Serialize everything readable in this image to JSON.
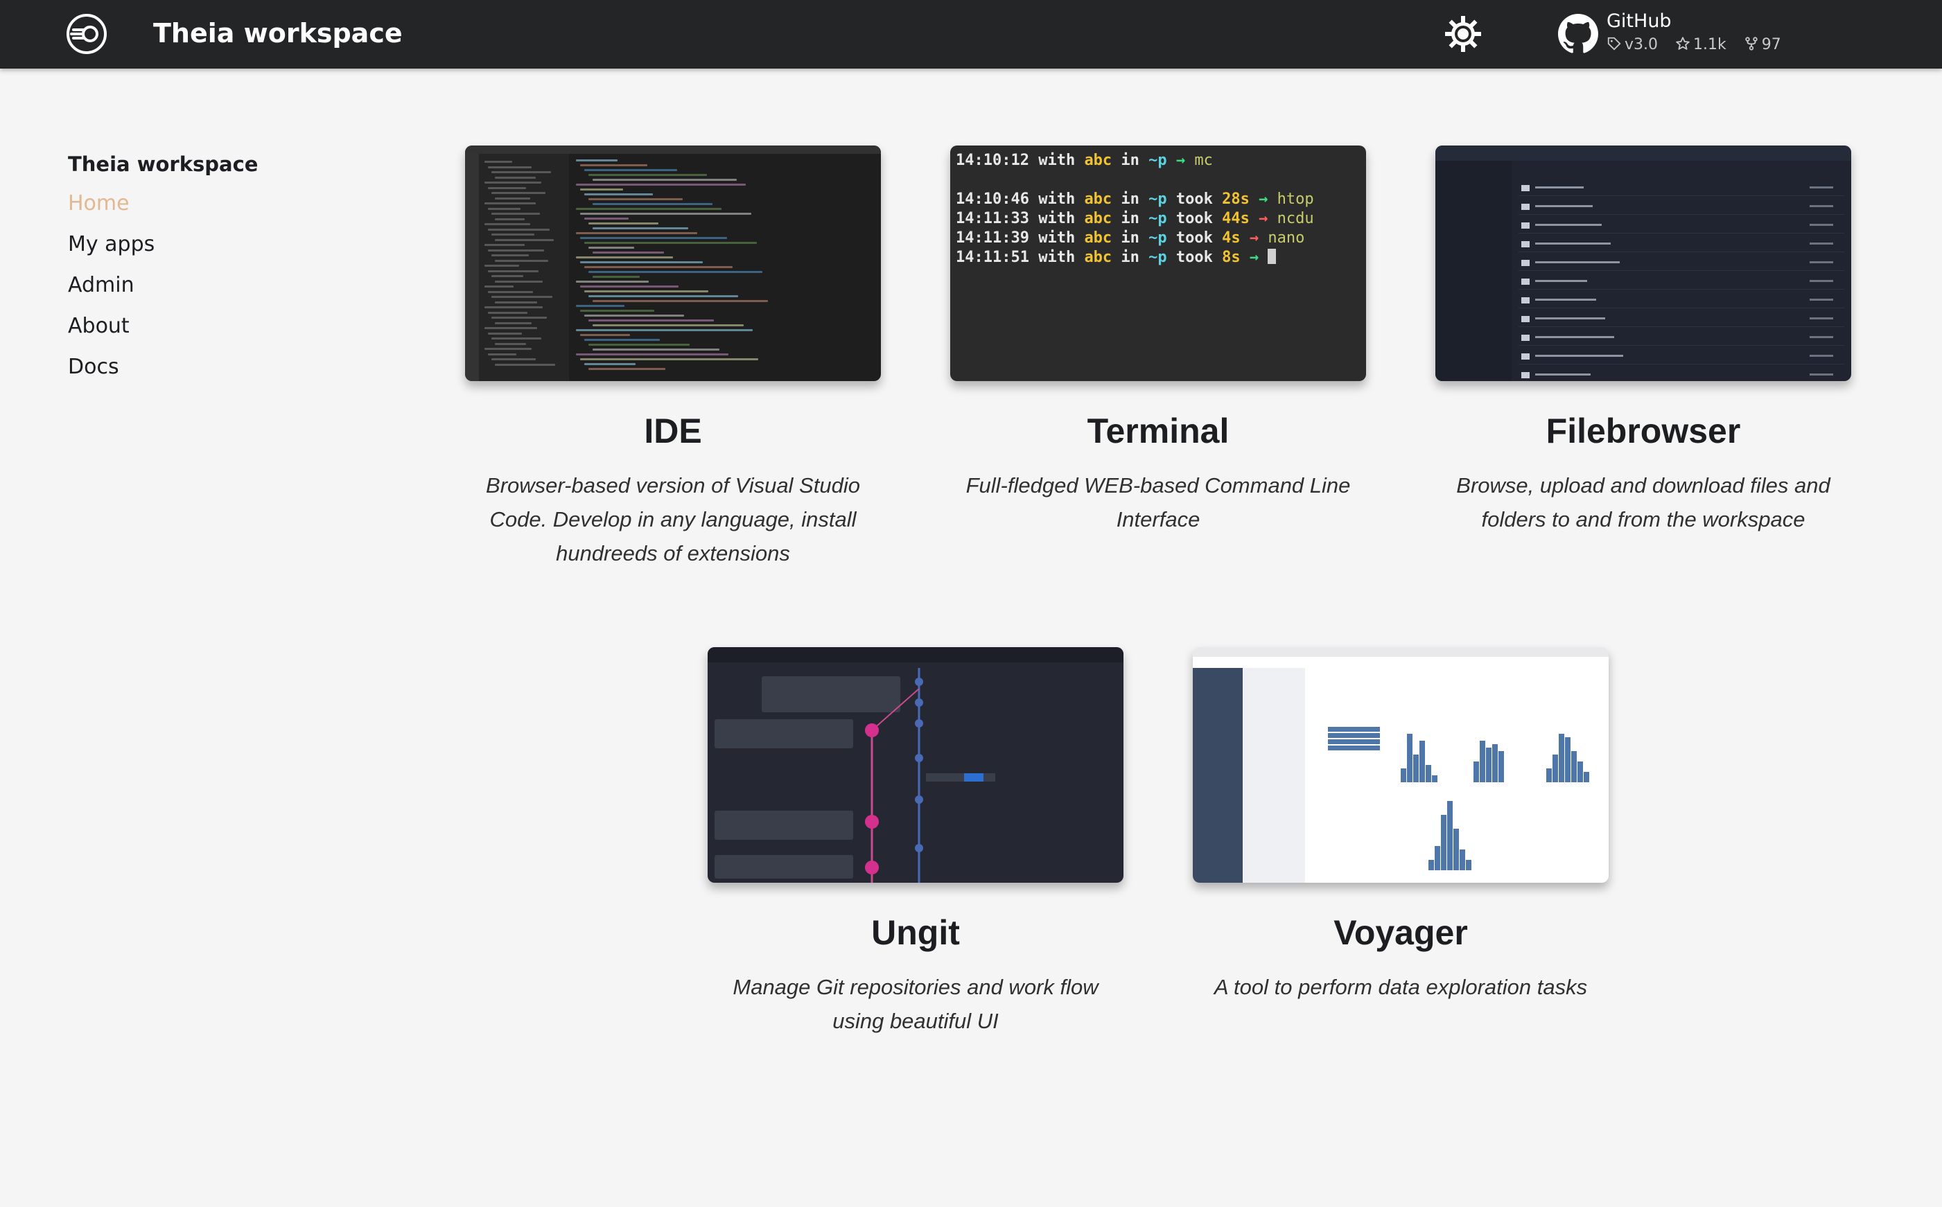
{
  "navbar": {
    "title": "Theia workspace",
    "github": {
      "label": "GitHub",
      "version": "v3.0",
      "stars": "1.1k",
      "forks": "97"
    }
  },
  "sidebar": {
    "title": "Theia workspace",
    "items": [
      {
        "label": "Home",
        "active": true
      },
      {
        "label": "My apps"
      },
      {
        "label": "Admin"
      },
      {
        "label": "About"
      },
      {
        "label": "Docs"
      }
    ]
  },
  "apps": [
    {
      "title": "IDE",
      "description": "Browser-based version of Visual Studio Code. Develop in any language, install hundreeds of extensions"
    },
    {
      "title": "Terminal",
      "description": "Full-fledged WEB-based Command Line Interface"
    },
    {
      "title": "Filebrowser",
      "description": "Browse, upload and download files and folders to and from the workspace"
    },
    {
      "title": "Ungit",
      "description": "Manage Git repositories and work flow using beautiful UI"
    },
    {
      "title": "Voyager",
      "description": "A tool to perform data exploration tasks"
    }
  ],
  "terminal_preview": {
    "lines": [
      {
        "time": "14:10:12",
        "user": "abc",
        "path": "~p",
        "took": "",
        "arrow": "ok",
        "cmd": "mc"
      },
      {
        "time": "14:10:46",
        "user": "abc",
        "path": "~p",
        "took": "28s",
        "arrow": "ok",
        "cmd": "htop"
      },
      {
        "time": "14:11:33",
        "user": "abc",
        "path": "~p",
        "took": "44s",
        "arrow": "err",
        "cmd": "ncdu"
      },
      {
        "time": "14:11:39",
        "user": "abc",
        "path": "~p",
        "took": "4s",
        "arrow": "err",
        "cmd": "nano"
      },
      {
        "time": "14:11:51",
        "user": "abc",
        "path": "~p",
        "took": "8s",
        "arrow": "ok",
        "cmd": ""
      }
    ]
  },
  "colors": {
    "navbar_bg": "#242526",
    "active_link": "#e3b891",
    "page_bg": "#f5f5f6"
  }
}
